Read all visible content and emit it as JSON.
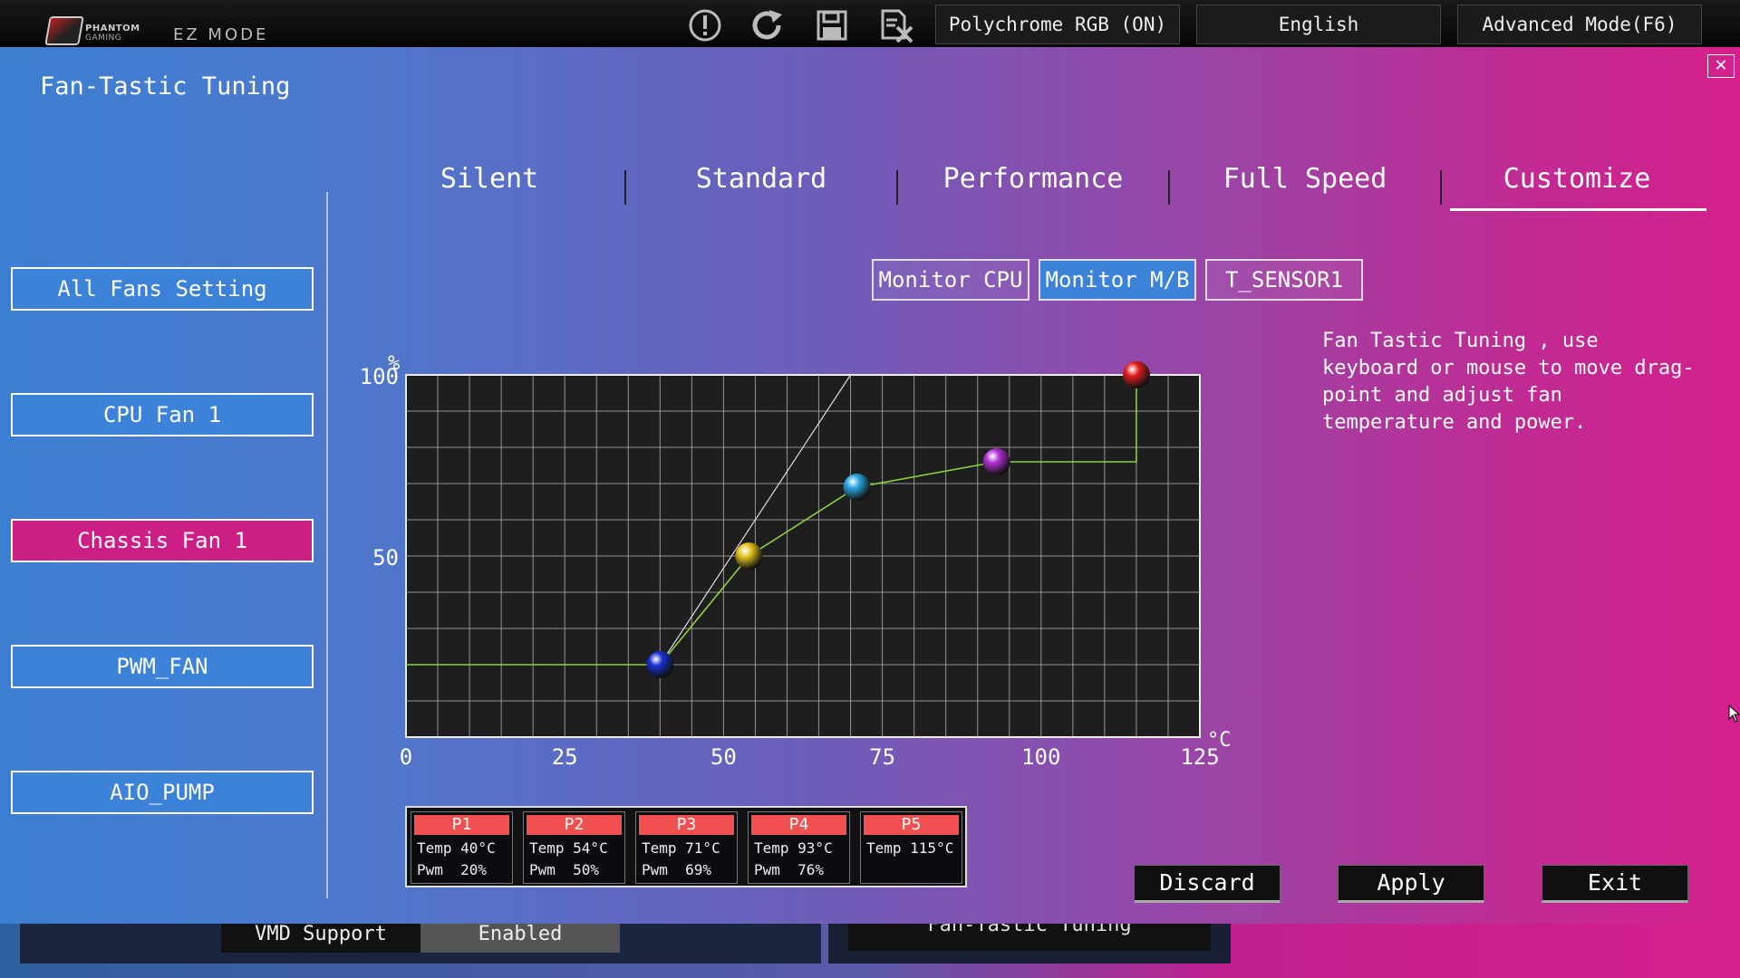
{
  "topbar": {
    "logo_line1": "PHANTOM",
    "logo_line2": "GAMING",
    "mode": "EZ MODE",
    "icons": [
      "warning-icon",
      "refresh-icon",
      "save-icon",
      "discard-file-icon"
    ],
    "polychrome_label": "Polychrome RGB (ON)",
    "language_label": "English",
    "advanced_label": "Advanced Mode(F6)"
  },
  "panel": {
    "title": "Fan-Tastic Tuning",
    "close_glyph": "✕"
  },
  "sidebar": {
    "items": [
      {
        "label": "All Fans Setting",
        "active": false
      },
      {
        "label": "CPU Fan 1",
        "active": false
      },
      {
        "label": "Chassis Fan 1",
        "active": true
      },
      {
        "label": "PWM_FAN",
        "active": false
      },
      {
        "label": "AIO_PUMP",
        "active": false
      }
    ]
  },
  "tabs": {
    "items": [
      "Silent",
      "Standard",
      "Performance",
      "Full Speed",
      "Customize"
    ],
    "selected": "Customize"
  },
  "monitor": {
    "items": [
      {
        "label": "Monitor CPU",
        "active": false
      },
      {
        "label": "Monitor M/B",
        "active": true
      },
      {
        "label": "T_SENSOR1",
        "active": false
      }
    ]
  },
  "help_text": "Fan Tastic Tuning , use keyboard or mouse to move drag-point and adjust fan temperature and power.",
  "chart_data": {
    "type": "line",
    "x_unit": "°C",
    "y_unit": "%",
    "xlim": [
      0,
      125
    ],
    "ylim": [
      0,
      100
    ],
    "x_ticks": [
      "0",
      "25",
      "50",
      "75",
      "100",
      "125"
    ],
    "y_ticks": [
      "100",
      "50"
    ],
    "grid": true,
    "points": [
      {
        "name": "P1",
        "temp": 40,
        "pwm": 20,
        "color": "#1a2fd0"
      },
      {
        "name": "P2",
        "temp": 54,
        "pwm": 50,
        "color": "#e2c21a"
      },
      {
        "name": "P3",
        "temp": 71,
        "pwm": 69,
        "color": "#27a5e0"
      },
      {
        "name": "P4",
        "temp": 93,
        "pwm": 76,
        "color": "#b22fd6"
      },
      {
        "name": "P5",
        "temp": 115,
        "pwm": 100,
        "color": "#e21c1c"
      }
    ],
    "curve_color": "#8ed23a",
    "reference_line": [
      [
        40,
        20
      ],
      [
        70,
        100
      ]
    ]
  },
  "point_table": [
    {
      "name": "P1",
      "temp": "Temp 40°C",
      "pwm": "Pwm  20%"
    },
    {
      "name": "P2",
      "temp": "Temp 54°C",
      "pwm": "Pwm  50%"
    },
    {
      "name": "P3",
      "temp": "Temp 71°C",
      "pwm": "Pwm  69%"
    },
    {
      "name": "P4",
      "temp": "Temp 93°C",
      "pwm": "Pwm  76%"
    },
    {
      "name": "P5",
      "temp": "Temp 115°C",
      "pwm": ""
    }
  ],
  "actions": {
    "discard": "Discard",
    "apply": "Apply",
    "exit": "Exit"
  },
  "background": {
    "vmd_label": "VMD Support",
    "vmd_value": "Enabled",
    "fan_label": "Fan-Tastic Tuning"
  }
}
